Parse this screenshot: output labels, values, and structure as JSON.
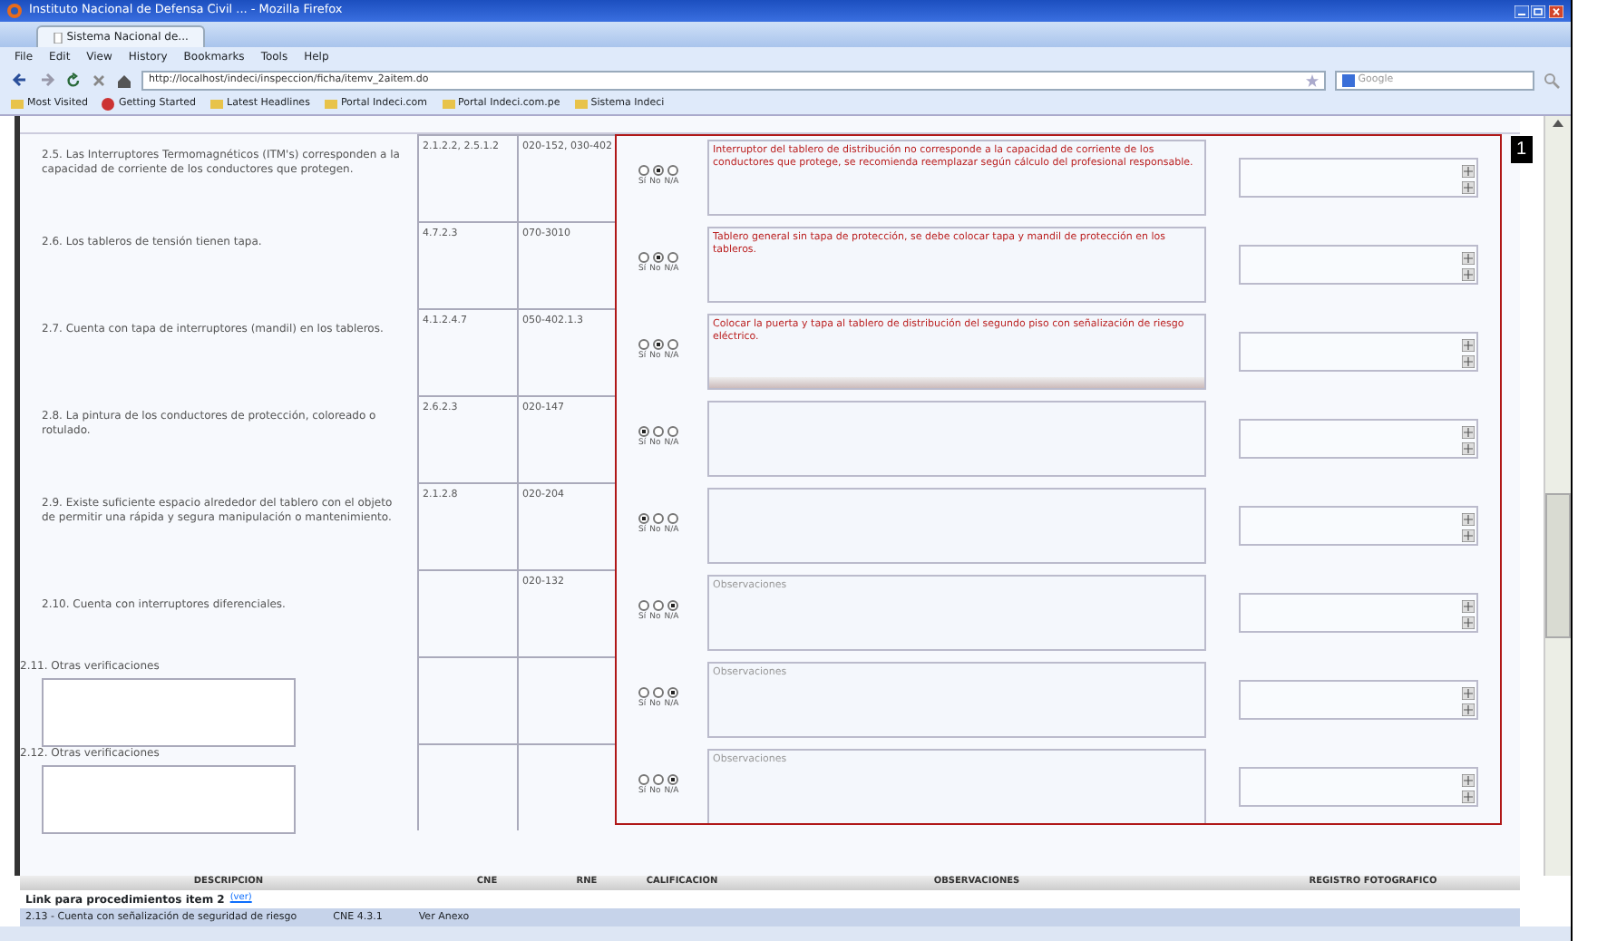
{
  "window": {
    "title": "Instituto Nacional de Defensa Civil ... - Mozilla Firefox"
  },
  "tab": {
    "label": "Sistema Nacional de..."
  },
  "menu": [
    "File",
    "Edit",
    "View",
    "History",
    "Bookmarks",
    "Tools",
    "Help"
  ],
  "address": "http://localhost/indeci/inspeccion/ficha/itemv_2aitem.do",
  "search": {
    "placeholder": "Google"
  },
  "bookmarks": [
    "Most Visited",
    "Getting Started",
    "Latest Headlines",
    "Portal Indeci.com",
    "Portal Indeci.com.pe",
    "Sistema Indeci"
  ],
  "rows": [
    {
      "kind": "item",
      "question": "2.5. Las Interruptores Termomagnéticos (ITM's) corresponden a la capacidad de corriente de los conductores que protegen.",
      "cne": "2.1.2.2, 2.5.1.2",
      "rne": "020-152, 030-402",
      "options": [
        {
          "selected": false
        },
        {
          "selected": true
        },
        {
          "selected": false
        }
      ],
      "option_labels": [
        "Sí",
        "No",
        "N/A"
      ],
      "observation": "Interruptor del tablero de distribución no corresponde a la capacidad de corriente de los conductores que protege, se recomienda reemplazar según cálculo del profesional responsable."
    },
    {
      "kind": "item",
      "question": "2.6. Los tableros de tensión tienen tapa.",
      "cne": "4.7.2.3",
      "rne": "070-3010",
      "options": [
        {
          "selected": false
        },
        {
          "selected": true
        },
        {
          "selected": false
        }
      ],
      "option_labels": [
        "Sí",
        "No",
        "N/A"
      ],
      "observation": "Tablero general sin tapa de protección, se debe colocar tapa y mandil de protección en los tableros."
    },
    {
      "kind": "item",
      "question": "2.7. Cuenta con tapa de interruptores (mandil) en los tableros.",
      "cne": "4.1.2.4.7",
      "rne": "050-402.1.3",
      "options": [
        {
          "selected": false
        },
        {
          "selected": true
        },
        {
          "selected": false
        }
      ],
      "option_labels": [
        "Sí",
        "No",
        "N/A"
      ],
      "observation": "Colocar la puerta y tapa al tablero de distribución del segundo piso con señalización de riesgo eléctrico.",
      "h_scroll": true
    },
    {
      "kind": "item",
      "question": "2.8. La pintura de los conductores de protección, coloreado o rotulado.",
      "cne": "2.6.2.3",
      "rne": "020-147",
      "options": [
        {
          "selected": true
        },
        {
          "selected": false
        },
        {
          "selected": false
        }
      ],
      "option_labels": [
        "Sí",
        "No",
        "N/A"
      ],
      "observation": ""
    },
    {
      "kind": "item",
      "question": "2.9. Existe suficiente espacio alrededor del tablero con el objeto de permitir una rápida y segura manipulación o mantenimiento.",
      "cne": "2.1.2.8",
      "rne": "020-204",
      "options": [
        {
          "selected": true
        },
        {
          "selected": false
        },
        {
          "selected": false
        }
      ],
      "option_labels": [
        "Sí",
        "No",
        "N/A"
      ],
      "observation": ""
    },
    {
      "kind": "item",
      "question": "2.10. Cuenta con interruptores diferenciales.",
      "cne": "",
      "rne": "020-132",
      "options": [
        {
          "selected": false
        },
        {
          "selected": false
        },
        {
          "selected": true
        }
      ],
      "option_labels": [
        "Sí",
        "No",
        "N/A"
      ],
      "observation": "",
      "placeholder": "Observaciones"
    },
    {
      "kind": "free",
      "question": "2.11. Otras verificaciones",
      "cne": "",
      "rne": "",
      "options": [
        {
          "selected": false
        },
        {
          "selected": false
        },
        {
          "selected": true
        }
      ],
      "option_labels": [
        "Sí",
        "No",
        "N/A"
      ],
      "observation": "",
      "placeholder": "Observaciones"
    },
    {
      "kind": "free",
      "question": "2.12. Otras verificaciones",
      "cne": "",
      "rne": "",
      "options": [
        {
          "selected": false
        },
        {
          "selected": false
        },
        {
          "selected": true
        }
      ],
      "option_labels": [
        "Sí",
        "No",
        "N/A"
      ],
      "observation": "",
      "placeholder": "Observaciones"
    }
  ],
  "footer_columns": [
    "DESCRIPCION",
    "CNE",
    "RNE",
    "CALIFICACION",
    "OBSERVACIONES",
    "REGISTRO FOTOGRAFICO"
  ],
  "link_row": {
    "text": "Link para procedimientos item 2",
    "link": "(ver)"
  },
  "next_row": {
    "question": "2.13 - Cuenta con señalización de seguridad de riesgo",
    "cne": "CNE 4.3.1",
    "rne": "Ver Anexo"
  },
  "annotation": {
    "label": "1"
  }
}
